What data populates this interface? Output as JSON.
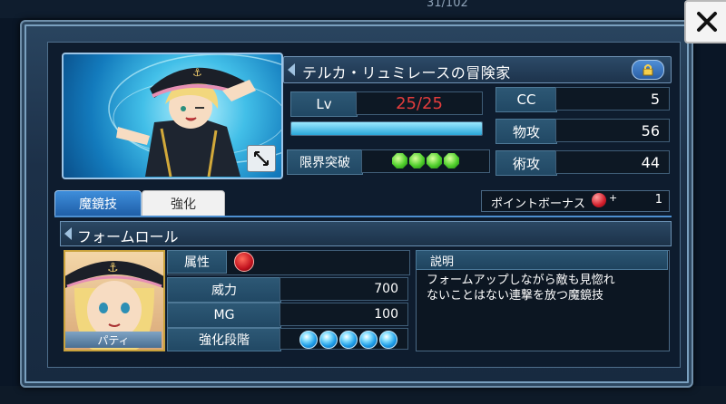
{
  "top_bar": {
    "counter": "31/102"
  },
  "character": {
    "title": "テルカ・リュミレースの冒険家",
    "level_label": "Lv",
    "level_value": "25/25",
    "exp_fraction": 1.0,
    "limit_break_label": "限界突破",
    "limit_break_count": 4,
    "stats": [
      {
        "label": "CC",
        "value": "5"
      },
      {
        "label": "物攻",
        "value": "56"
      },
      {
        "label": "術攻",
        "value": "44"
      }
    ]
  },
  "tabs": [
    {
      "label": "魔鏡技",
      "active": true
    },
    {
      "label": "強化",
      "active": false
    }
  ],
  "point_bonus": {
    "label": "ポイントボーナス",
    "plus": "+",
    "value": "1"
  },
  "skill": {
    "name": "フォームロール",
    "attribute_label": "属性",
    "attribute_icon": "fire-element-icon",
    "rows": [
      {
        "label": "威力",
        "value": "700"
      },
      {
        "label": "MG",
        "value": "100"
      }
    ],
    "upgrade_label": "強化段階",
    "upgrade_count": 5,
    "description_label": "説明",
    "description": "フォームアップしながら敵も見惚れ\nないことはない連撃を放つ魔鏡技"
  },
  "portrait_name": "パティ",
  "colors": {
    "accent": "#3e8edb",
    "level": "#e23c3c",
    "frame": "#6f8faa"
  }
}
